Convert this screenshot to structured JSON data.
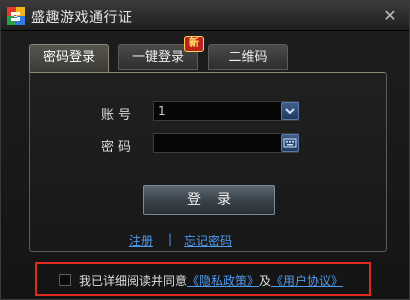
{
  "window": {
    "title": "盛趣游戏通行证",
    "close_icon": "✕"
  },
  "tabs": [
    {
      "label": "密码登录",
      "active": true
    },
    {
      "label": "一键登录",
      "active": false,
      "badge": "新"
    },
    {
      "label": "二维码",
      "active": false
    }
  ],
  "form": {
    "account_label": "账号",
    "account_value": "1",
    "password_label": "密码",
    "password_value": "",
    "login_label": "登录"
  },
  "links": {
    "register": "注册",
    "separator": "|",
    "forgot_password": "忘记密码"
  },
  "agreement": {
    "prefix": "我已详细阅读并同意",
    "privacy_policy": "《隐私政策》",
    "conjunction": "及",
    "user_agreement": "《用户协议》",
    "checked": false
  },
  "colors": {
    "accent_link": "#4f9bf0",
    "highlight_border": "#e0291f",
    "badge_bg": "#c0221b"
  }
}
